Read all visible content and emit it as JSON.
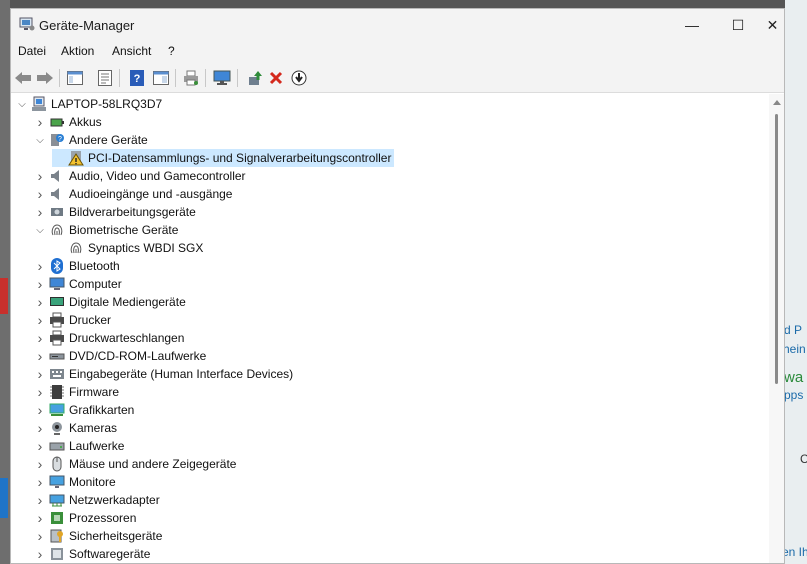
{
  "window": {
    "title": "Geräte-Manager",
    "controls": {
      "minimize": "—",
      "maximize": "☐",
      "close": "✕"
    }
  },
  "menu": [
    "Datei",
    "Aktion",
    "Ansicht",
    "?"
  ],
  "toolbar": {
    "buttons": [
      "back-icon",
      "forward-icon",
      "console-tree-icon",
      "properties-icon",
      "help-icon",
      "action-pane-icon",
      "print-icon",
      "monitor-scan-icon",
      "update-driver-icon",
      "uninstall-icon",
      "disable-icon"
    ]
  },
  "tree": {
    "root": "LAPTOP-58LRQ3D7",
    "items": [
      {
        "label": "Akkus",
        "level": 1,
        "expanded": false,
        "icon": "battery-icon"
      },
      {
        "label": "Andere Geräte",
        "level": 1,
        "expanded": true,
        "icon": "unknown-device-icon"
      },
      {
        "label": "PCI-Datensammlungs- und Signalverarbeitungscontroller",
        "level": 2,
        "icon": "warning-device-icon",
        "selected": true
      },
      {
        "label": "Audio, Video und Gamecontroller",
        "level": 1,
        "expanded": false,
        "icon": "speaker-icon"
      },
      {
        "label": "Audioeingänge und -ausgänge",
        "level": 1,
        "expanded": false,
        "icon": "speaker-icon"
      },
      {
        "label": "Bildverarbeitungsgeräte",
        "level": 1,
        "expanded": false,
        "icon": "camera-device-icon"
      },
      {
        "label": "Biometrische Geräte",
        "level": 1,
        "expanded": true,
        "icon": "fingerprint-icon"
      },
      {
        "label": "Synaptics WBDI SGX",
        "level": 2,
        "icon": "fingerprint-icon"
      },
      {
        "label": "Bluetooth",
        "level": 1,
        "expanded": false,
        "icon": "bluetooth-icon"
      },
      {
        "label": "Computer",
        "level": 1,
        "expanded": false,
        "icon": "computer-icon"
      },
      {
        "label": "Digitale Mediengeräte",
        "level": 1,
        "expanded": false,
        "icon": "media-device-icon"
      },
      {
        "label": "Drucker",
        "level": 1,
        "expanded": false,
        "icon": "printer-icon"
      },
      {
        "label": "Druckwarteschlangen",
        "level": 1,
        "expanded": false,
        "icon": "printer-icon"
      },
      {
        "label": "DVD/CD-ROM-Laufwerke",
        "level": 1,
        "expanded": false,
        "icon": "disc-drive-icon"
      },
      {
        "label": "Eingabegeräte (Human Interface Devices)",
        "level": 1,
        "expanded": false,
        "icon": "hid-icon"
      },
      {
        "label": "Firmware",
        "level": 1,
        "expanded": false,
        "icon": "chip-icon"
      },
      {
        "label": "Grafikkarten",
        "level": 1,
        "expanded": false,
        "icon": "display-adapter-icon"
      },
      {
        "label": "Kameras",
        "level": 1,
        "expanded": false,
        "icon": "webcam-icon"
      },
      {
        "label": "Laufwerke",
        "level": 1,
        "expanded": false,
        "icon": "disk-drive-icon"
      },
      {
        "label": "Mäuse und andere Zeigegeräte",
        "level": 1,
        "expanded": false,
        "icon": "mouse-icon"
      },
      {
        "label": "Monitore",
        "level": 1,
        "expanded": false,
        "icon": "monitor-icon"
      },
      {
        "label": "Netzwerkadapter",
        "level": 1,
        "expanded": false,
        "icon": "network-adapter-icon"
      },
      {
        "label": "Prozessoren",
        "level": 1,
        "expanded": false,
        "icon": "processor-icon"
      },
      {
        "label": "Sicherheitsgeräte",
        "level": 1,
        "expanded": false,
        "icon": "security-key-icon"
      },
      {
        "label": "Softwaregeräte",
        "level": 1,
        "expanded": false,
        "icon": "software-device-icon"
      }
    ]
  },
  "background_fragments": [
    "d P",
    "hein",
    "wa",
    "pps",
    "C",
    "en Ih"
  ],
  "colors": {
    "selection": "#cce8ff",
    "uninstall_red": "#d4281c",
    "update_green": "#2e8b3a"
  }
}
